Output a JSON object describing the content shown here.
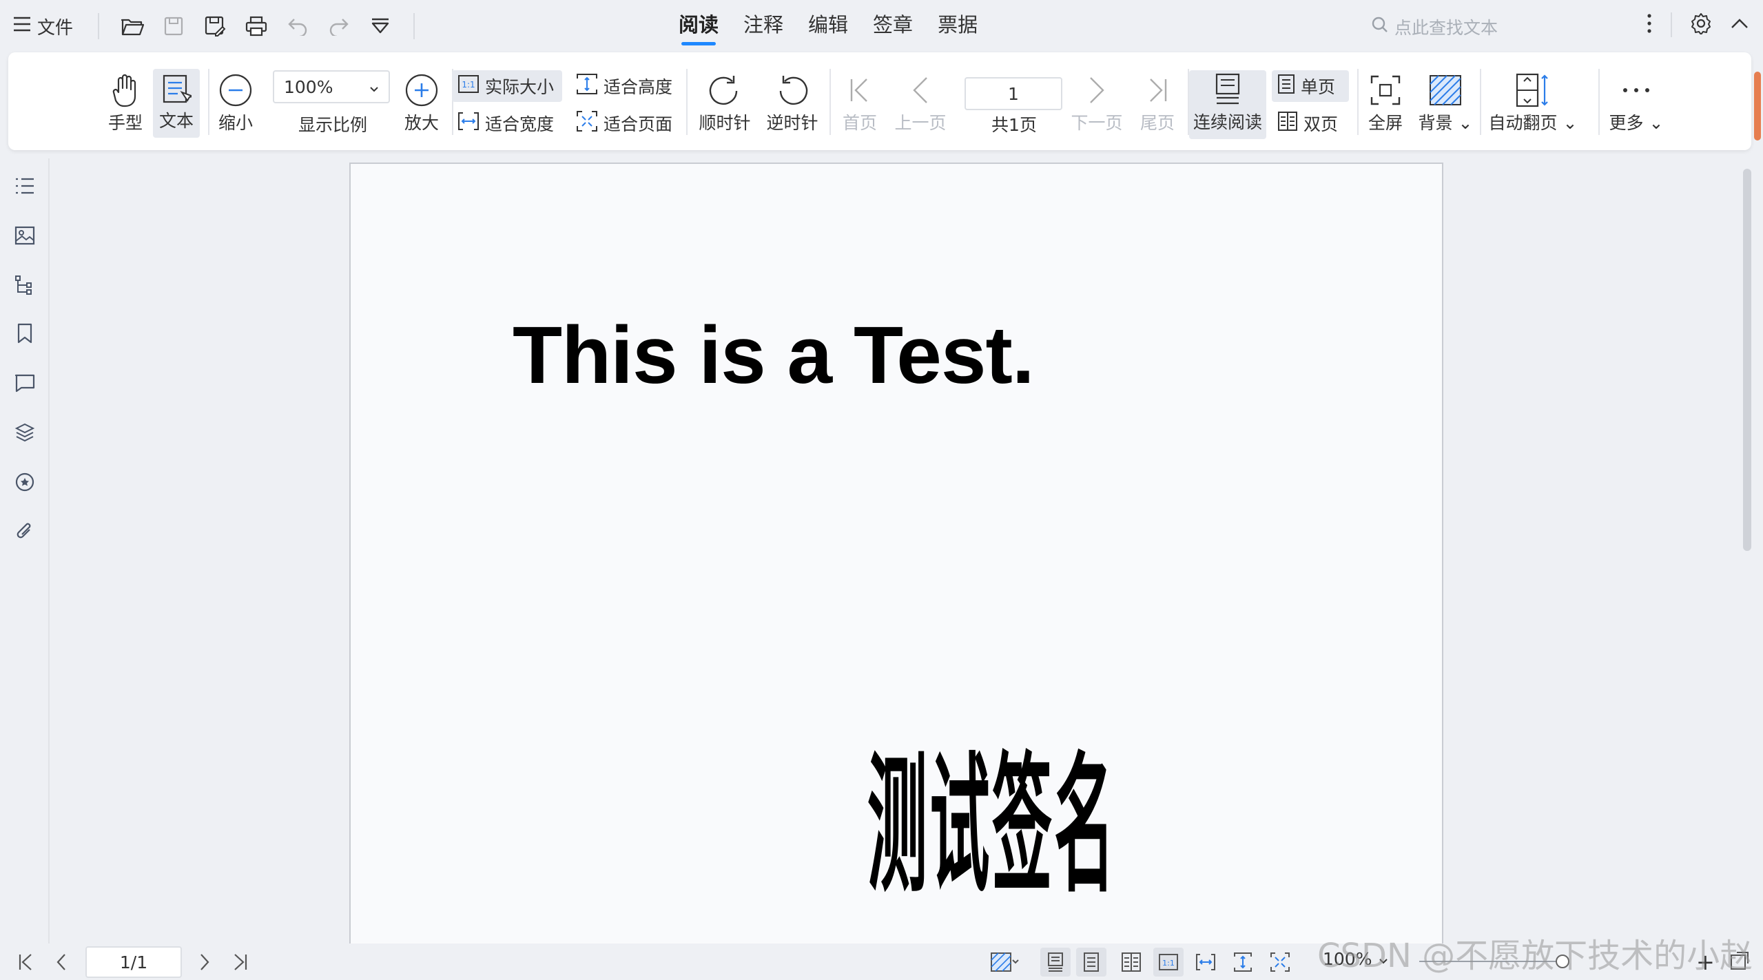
{
  "topbar": {
    "menu_label": "文件",
    "tabs": [
      "阅读",
      "注释",
      "编辑",
      "签章",
      "票据"
    ],
    "active_tab": "阅读",
    "search_placeholder": "点此查找文本"
  },
  "ribbon": {
    "hand": "手型",
    "text": "文本",
    "zoom_out": "缩小",
    "zoom_value": "100%",
    "zoom_label": "显示比例",
    "zoom_in": "放大",
    "actual_size": "实际大小",
    "fit_width": "适合宽度",
    "fit_height": "适合高度",
    "fit_page": "适合页面",
    "rotate_cw": "顺时针",
    "rotate_ccw": "逆时针",
    "first_page": "首页",
    "prev_page": "上一页",
    "page_number": "1",
    "total_pages": "共1页",
    "next_page": "下一页",
    "last_page": "尾页",
    "continuous": "连续阅读",
    "single_page": "单页",
    "double_page": "双页",
    "fullscreen": "全屏",
    "background": "背景",
    "auto_flip": "自动翻页",
    "more": "更多"
  },
  "document": {
    "title": "This is a Test.",
    "signature": "测试签名"
  },
  "statusbar": {
    "page_indicator": "1/1",
    "zoom": "100%",
    "plus": "+"
  },
  "watermark": "CSDN @不愿放下技术的小赵",
  "colors": {
    "accent": "#1e88ff",
    "background": "#eef0f4",
    "scroll_marker": "#e67e50"
  }
}
